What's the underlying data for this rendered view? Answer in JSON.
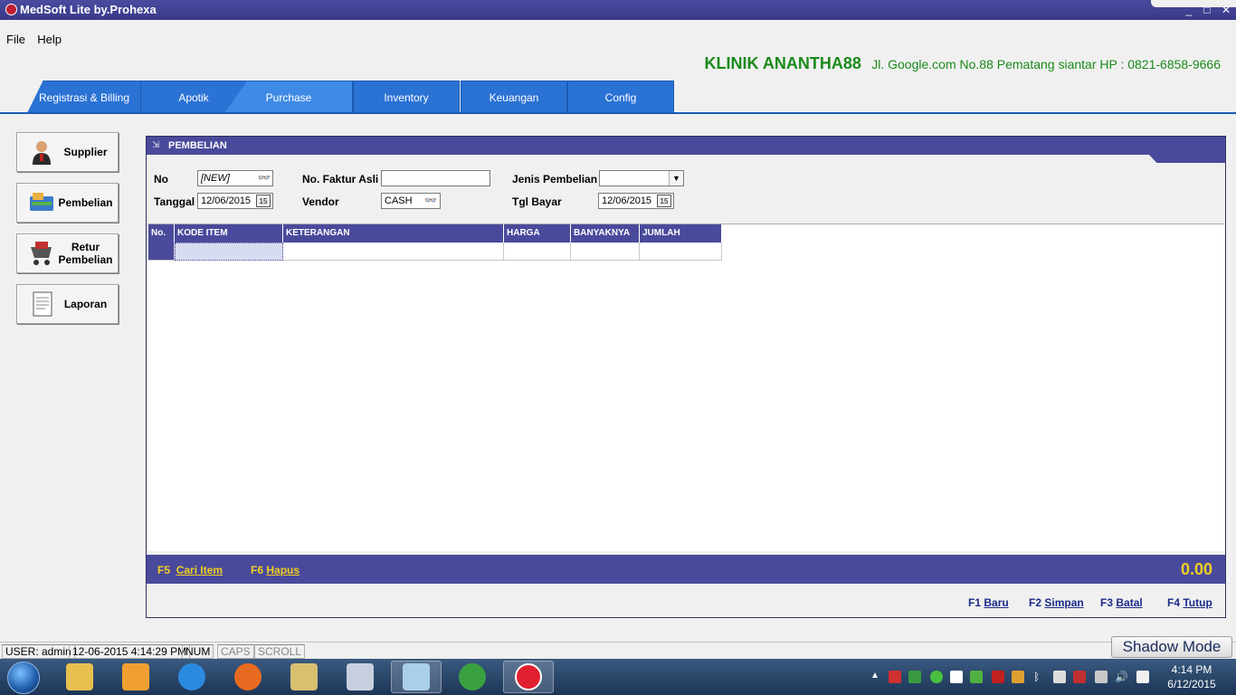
{
  "window": {
    "title": "MedSoft Lite by.Prohexa",
    "minimize": "_",
    "maximize": "□",
    "close": "✕"
  },
  "menu": [
    "File",
    "Help"
  ],
  "clinic": {
    "name": "KLINIK ANANTHA88",
    "address": "Jl. Google.com No.88  Pematang siantar HP : 0821-6858-9666"
  },
  "tabs": [
    {
      "label": "Registrasi & Billing",
      "active": false
    },
    {
      "label": "Apotik",
      "active": false
    },
    {
      "label": "Purchase",
      "active": true
    },
    {
      "label": "Inventory",
      "active": false
    },
    {
      "label": "Keuangan",
      "active": false
    },
    {
      "label": "Config",
      "active": false
    }
  ],
  "sidebar": [
    {
      "label": "Supplier",
      "icon": "supplier-icon"
    },
    {
      "label": "Pembelian",
      "icon": "pembelian-icon"
    },
    {
      "label": "Retur Pembelian",
      "icon": "retur-pembelian-icon"
    },
    {
      "label": "Laporan",
      "icon": "laporan-icon"
    }
  ],
  "form": {
    "title": "PEMBELIAN",
    "fields": {
      "no_label": "No",
      "no_value": "[NEW]",
      "tanggal_label": "Tanggal",
      "tanggal_value": "12/06/2015",
      "faktur_label": "No. Faktur Asli",
      "faktur_value": "",
      "vendor_label": "Vendor",
      "vendor_value": "CASH",
      "jenis_label": "Jenis Pembelian",
      "jenis_value": "",
      "tgl_bayar_label": "Tgl Bayar",
      "tgl_bayar_value": "12/06/2015"
    },
    "grid": {
      "columns": [
        "No.",
        "KODE ITEM",
        "KETERANGAN",
        "HARGA",
        "BANYAKNYA",
        "JUMLAH"
      ],
      "rows": [
        [
          "",
          "",
          "",
          "",
          "",
          ""
        ]
      ]
    },
    "fkeys": {
      "cari": "Cari Item",
      "cari_key": "F5",
      "hapus": "Hapus",
      "hapus_key": "F6"
    },
    "total": "0.00",
    "actions": {
      "baru_key": "F1",
      "baru": "Baru",
      "simpan_key": "F2",
      "simpan": "Simpan",
      "batal_key": "F3",
      "batal": "Batal",
      "tutup_key": "F4",
      "tutup": "Tutup"
    }
  },
  "statusbar": {
    "user": "USER: admin",
    "datetime": "12-06-2015 4:14:29 PM",
    "num": "NUM",
    "caps": "CAPS",
    "scroll": "SCROLL"
  },
  "shadow_mode": "Shadow Mode",
  "taskbar": {
    "apps": [
      "file-explorer-icon",
      "media-player-icon",
      "internet-explorer-icon",
      "firefox-icon",
      "notepad-icon",
      "window-manager-icon",
      "glass-app-icon",
      "globe-icon",
      "medsoft-icon"
    ],
    "clock_time": "4:14 PM",
    "clock_date": "6/12/2015"
  },
  "colors": {
    "header_blue": "#4a4a9c",
    "tab_blue": "#2a72d4",
    "clinic_green": "#1a8a1a",
    "fkey_yellow": "#f0d020"
  }
}
